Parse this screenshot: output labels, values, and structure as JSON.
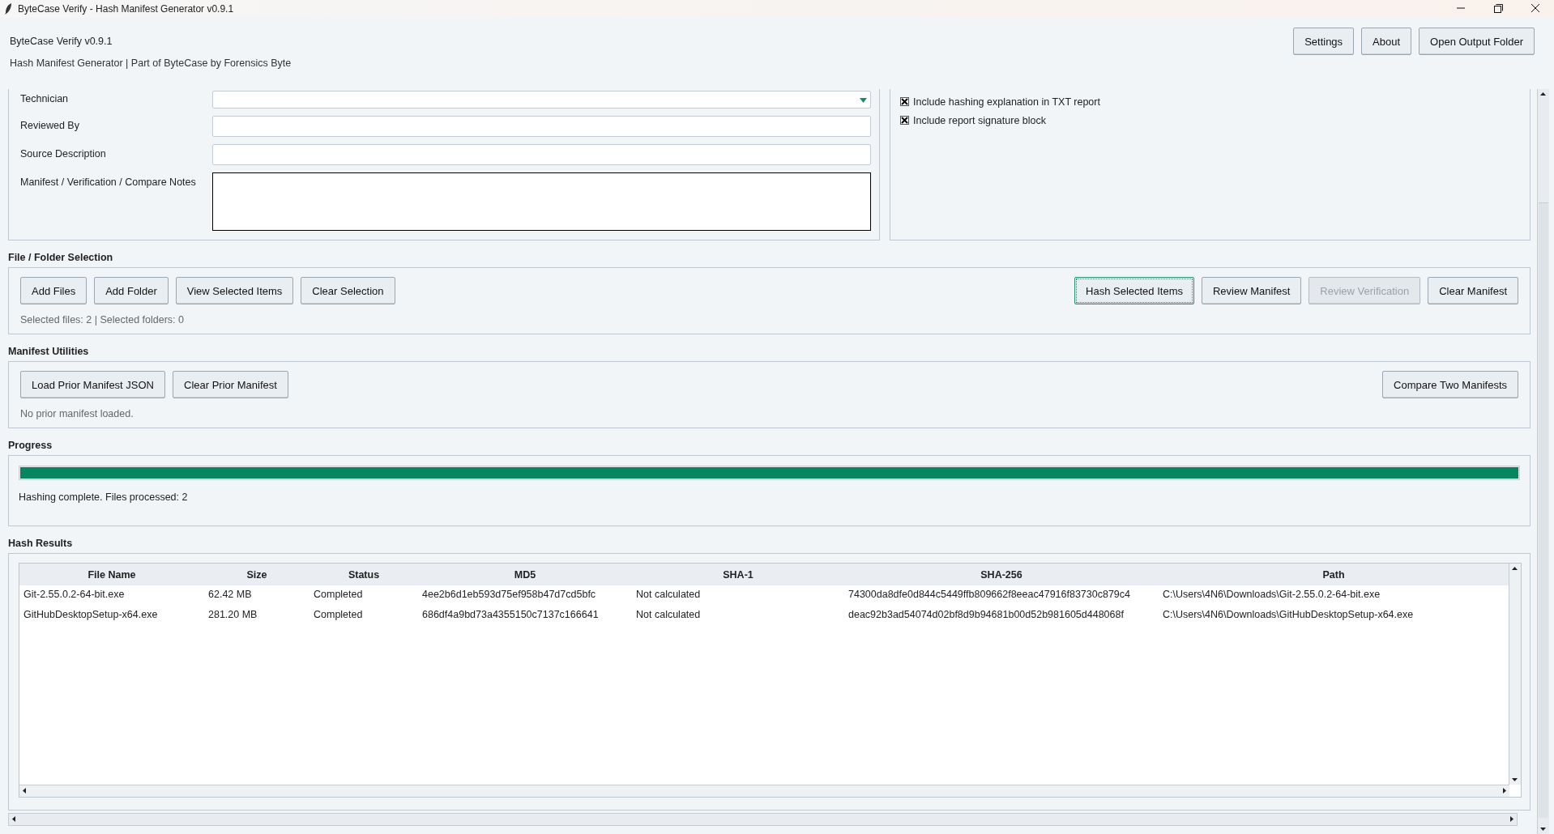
{
  "window": {
    "title": "ByteCase Verify - Hash Manifest Generator v0.9.1"
  },
  "header": {
    "app_name": "ByteCase Verify v0.9.1",
    "subtitle": "Hash Manifest Generator | Part of ByteCase by Forensics Byte",
    "buttons": [
      "Settings",
      "About",
      "Open Output Folder"
    ]
  },
  "case_fields": [
    {
      "kind": "combo",
      "label": "Technician"
    },
    {
      "kind": "text",
      "label": "Reviewed By"
    },
    {
      "kind": "text",
      "label": "Source Description"
    },
    {
      "kind": "notes",
      "label": "Manifest / Verification / Compare Notes"
    }
  ],
  "report_options": [
    {
      "label": "Include hashing explanation in TXT report",
      "checked": true
    },
    {
      "label": "Include report signature block",
      "checked": true
    }
  ],
  "file_selection": {
    "title": "File / Folder Selection",
    "left_buttons": [
      {
        "label": "Add Files",
        "disabled": false,
        "focused": false
      },
      {
        "label": "Add Folder",
        "disabled": false,
        "focused": false
      },
      {
        "label": "View Selected Items",
        "disabled": false,
        "focused": false
      },
      {
        "label": "Clear Selection",
        "disabled": false,
        "focused": false
      }
    ],
    "right_buttons": [
      {
        "label": "Hash Selected Items",
        "disabled": false,
        "focused": true
      },
      {
        "label": "Review Manifest",
        "disabled": false,
        "focused": false
      },
      {
        "label": "Review Verification",
        "disabled": true,
        "focused": false
      },
      {
        "label": "Clear Manifest",
        "disabled": false,
        "focused": false
      }
    ],
    "status": "Selected files: 2 | Selected folders: 0"
  },
  "manifest_utilities": {
    "title": "Manifest Utilities",
    "left_buttons": [
      {
        "label": "Load Prior Manifest JSON",
        "disabled": false,
        "focused": false
      },
      {
        "label": "Clear Prior Manifest",
        "disabled": false,
        "focused": false
      }
    ],
    "right_buttons": [
      {
        "label": "Compare Two Manifests",
        "disabled": false,
        "focused": false
      }
    ],
    "status": "No prior manifest loaded."
  },
  "progress": {
    "title": "Progress",
    "level": 1.0,
    "status": "Hashing complete. Files processed: 2"
  },
  "hash_results": {
    "title": "Hash Results",
    "columns": [
      "File Name",
      "Size",
      "Status",
      "MD5",
      "SHA-1",
      "SHA-256",
      "Path"
    ],
    "rows": [
      [
        "Git-2.55.0.2-64-bit.exe",
        "62.42 MB",
        "Completed",
        "4ee2b6d1eb593d75ef958b47d7cd5bfc",
        "Not calculated",
        "74300da8dfe0d844c5449ffb809662f8eeac47916f83730c879c4",
        "C:\\Users\\4N6\\Downloads\\Git-2.55.0.2-64-bit.exe"
      ],
      [
        "GitHubDesktopSetup-x64.exe",
        "281.20 MB",
        "Completed",
        "686df4a9bd73a4355150c7137c166641",
        "Not calculated",
        "deac92b3ad54074d02bf8d9b94681b00d52b981605d448068f",
        "C:\\Users\\4N6\\Downloads\\GitHubDesktopSetup-x64.exe"
      ]
    ]
  }
}
